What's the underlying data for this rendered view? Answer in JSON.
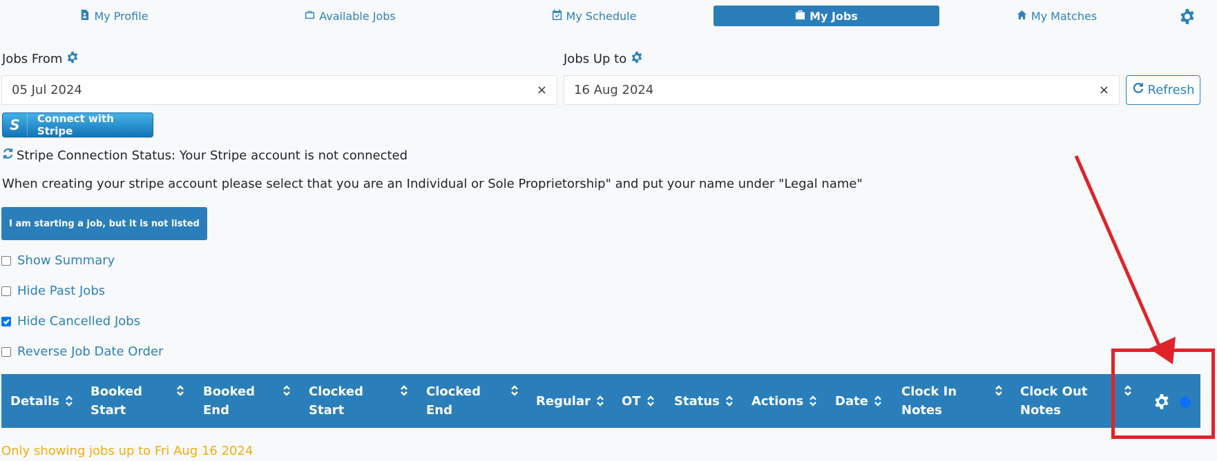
{
  "nav": {
    "items": [
      {
        "label": "My Profile",
        "icon": "profile-icon"
      },
      {
        "label": "Available Jobs",
        "icon": "briefcase-icon"
      },
      {
        "label": "My Schedule",
        "icon": "calendar-check-icon"
      },
      {
        "label": "My Jobs",
        "icon": "briefcase-icon",
        "active": true
      },
      {
        "label": "My Matches",
        "icon": "home-icon"
      }
    ],
    "settings_icon": "gear-icon"
  },
  "filters": {
    "from_label": "Jobs From",
    "from_value": "05 Jul 2024",
    "to_label": "Jobs Up to",
    "to_value": "16 Aug 2024",
    "clear_glyph": "×",
    "refresh_label": "Refresh"
  },
  "stripe": {
    "logo_letter": "S",
    "button_label": "Connect with Stripe",
    "status_text": "Stripe Connection Status: Your Stripe account is not connected",
    "note": "When creating your stripe account please select that you are an Individual or Sole Proprietorship\" and put your name under \"Legal name\""
  },
  "not_listed_button": "I am starting a job, but it is not listed",
  "options": [
    {
      "label": "Show Summary",
      "checked": false
    },
    {
      "label": "Hide Past Jobs",
      "checked": false
    },
    {
      "label": "Hide Cancelled Jobs",
      "checked": true
    },
    {
      "label": "Reverse Job Date Order",
      "checked": false
    }
  ],
  "table": {
    "columns": [
      {
        "line1": "Details",
        "line2": ""
      },
      {
        "line1": "Booked",
        "line2": "Start"
      },
      {
        "line1": "Booked",
        "line2": "End"
      },
      {
        "line1": "Clocked",
        "line2": "Start"
      },
      {
        "line1": "Clocked",
        "line2": "End"
      },
      {
        "line1": "Regular",
        "line2": ""
      },
      {
        "line1": "OT",
        "line2": ""
      },
      {
        "line1": "Status",
        "line2": ""
      },
      {
        "line1": "Actions",
        "line2": ""
      },
      {
        "line1": "Date",
        "line2": ""
      },
      {
        "line1": "Clock In",
        "line2": "Notes"
      },
      {
        "line1": "Clock Out",
        "line2": "Notes"
      }
    ]
  },
  "footer_note": "Only showing jobs up to Fri Aug 16 2024",
  "colors": {
    "primary": "#2a7fba",
    "link": "#2b82ba",
    "warning_text": "#f0ad10",
    "annotation": "#e0232a"
  }
}
